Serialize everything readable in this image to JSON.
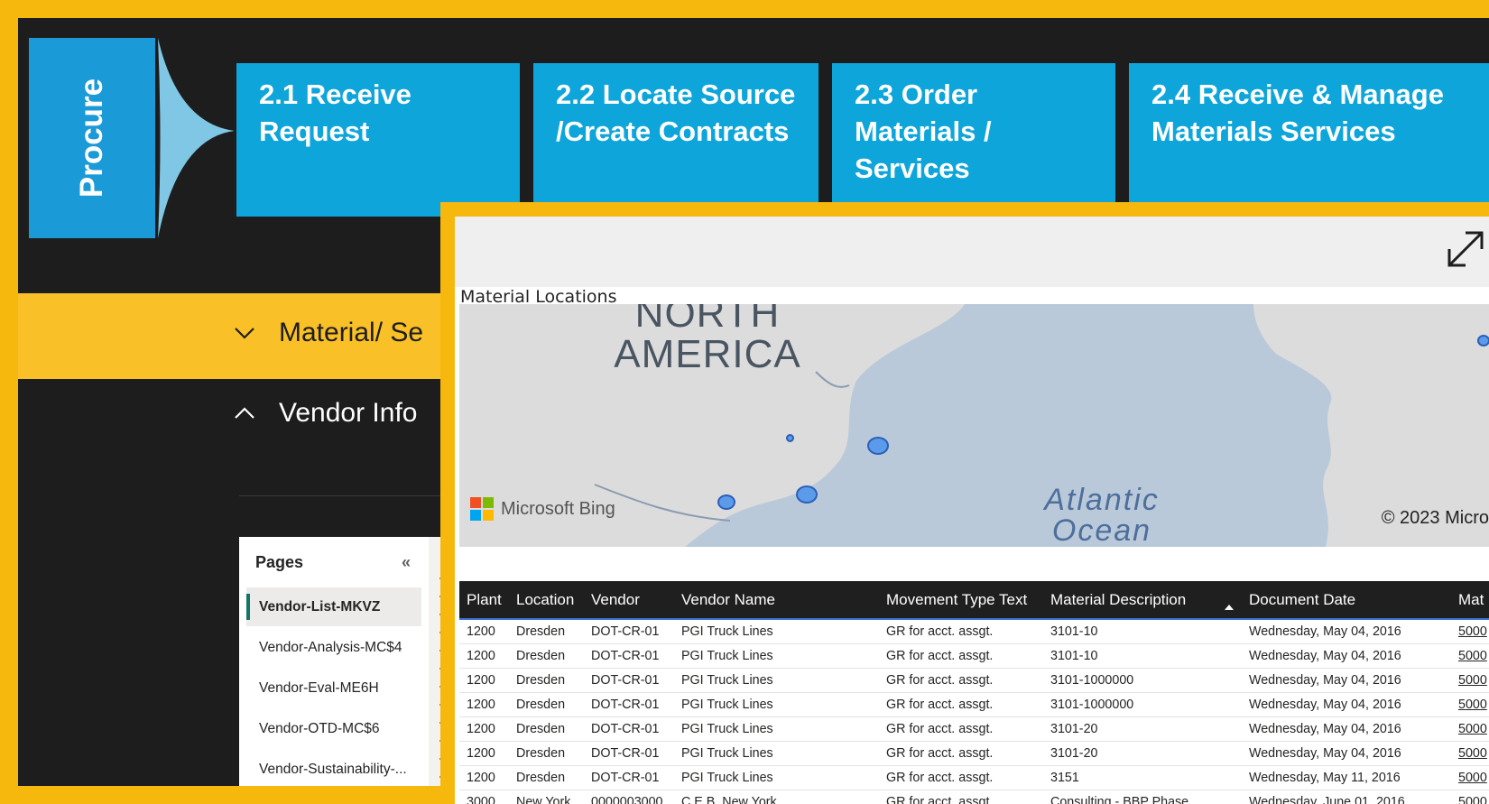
{
  "header": {
    "phase_label": "Procure",
    "steps": [
      {
        "label": "2.1 Receive Request"
      },
      {
        "label": "2.2 Locate Source /Create Contracts"
      },
      {
        "label": "2.3 Order Materials / Services"
      },
      {
        "label": "2.4 Receive & Manage Materials Services"
      }
    ]
  },
  "sections": {
    "material": {
      "label": "Material/ Se"
    },
    "vendor": {
      "label": "Vendor Info"
    }
  },
  "pages_panel": {
    "title": "Pages",
    "collapse_icon": "double-chevron-left-icon",
    "items": [
      {
        "label": "Vendor-List-MKVZ",
        "active": true
      },
      {
        "label": "Vendor-Analysis-MC$4"
      },
      {
        "label": "Vendor-Eval-ME6H"
      },
      {
        "label": "Vendor-OTD-MC$6"
      },
      {
        "label": "Vendor-Sustainability-..."
      }
    ]
  },
  "report": {
    "focus_icon": "expand-diagonal-icon",
    "map": {
      "title": "Material Locations",
      "continent_label": "NORTH AMERICA",
      "ocean_label": "Atlantic Ocean",
      "provider": "Microsoft Bing",
      "copyright": "© 2023 Micro",
      "accent_color": "#5b9bea"
    },
    "table": {
      "columns": [
        "Plant",
        "Location",
        "Vendor",
        "Vendor Name",
        "Movement Type Text",
        "Material Description",
        "Document Date",
        "Mat"
      ],
      "sorted_column": "Document Date",
      "rows": [
        [
          "1200",
          "Dresden",
          "DOT-CR-01",
          "PGI Truck Lines",
          "GR for acct. assgt.",
          "3101-10",
          "Wednesday, May 04, 2016",
          "5000"
        ],
        [
          "1200",
          "Dresden",
          "DOT-CR-01",
          "PGI Truck Lines",
          "GR for acct. assgt.",
          "3101-10",
          "Wednesday, May 04, 2016",
          "5000"
        ],
        [
          "1200",
          "Dresden",
          "DOT-CR-01",
          "PGI Truck Lines",
          "GR for acct. assgt.",
          "3101-1000000",
          "Wednesday, May 04, 2016",
          "5000"
        ],
        [
          "1200",
          "Dresden",
          "DOT-CR-01",
          "PGI Truck Lines",
          "GR for acct. assgt.",
          "3101-1000000",
          "Wednesday, May 04, 2016",
          "5000"
        ],
        [
          "1200",
          "Dresden",
          "DOT-CR-01",
          "PGI Truck Lines",
          "GR for acct. assgt.",
          "3101-20",
          "Wednesday, May 04, 2016",
          "5000"
        ],
        [
          "1200",
          "Dresden",
          "DOT-CR-01",
          "PGI Truck Lines",
          "GR for acct. assgt.",
          "3101-20",
          "Wednesday, May 04, 2016",
          "5000"
        ],
        [
          "1200",
          "Dresden",
          "DOT-CR-01",
          "PGI Truck Lines",
          "GR for acct. assgt.",
          "3151",
          "Wednesday, May 11, 2016",
          "5000"
        ],
        [
          "3000",
          "New York",
          "0000003000",
          "C.E.B. New York",
          "GR for acct. assgt.",
          "Consulting - BBP Phase",
          "Wednesday, June 01, 2016",
          "5000"
        ]
      ]
    }
  },
  "colors": {
    "frame": "#f6b80d",
    "band": "#fac027",
    "step": "#0ea5da",
    "procure": "#1a9ad6"
  }
}
